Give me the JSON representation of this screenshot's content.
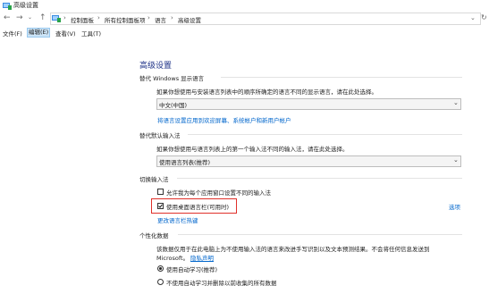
{
  "window": {
    "title": "高级设置"
  },
  "nav": {
    "back_glyph": "←",
    "forward_glyph": "→",
    "recent_glyph": "⌄",
    "up_glyph": "↑",
    "breadcrumbs": [
      "控制面板",
      "所有控制面板项",
      "语言",
      "高级设置"
    ],
    "separator": "›",
    "dropdown_glyph": "⌄",
    "refresh_glyph": "↻"
  },
  "menu": {
    "items": [
      "文件(F)",
      "编辑(E)",
      "查看(V)",
      "工具(T)"
    ]
  },
  "page": {
    "heading": "高级设置",
    "display_language": {
      "title": "替代 Windows 显示语言",
      "description": "如果你想使用与安装语言列表中的顺序所确定的语言不同的显示语言，请在此处选择。",
      "selected": "中文(中国)",
      "link": "将语言设置应用到欢迎屏幕、系统帐户和新用户帐户"
    },
    "default_input": {
      "title": "替代默认输入法",
      "description": "如果你想使用与语言列表上的第一个输入法不同的输入法，请在此处选择。",
      "selected": "使用语言列表(推荐)"
    },
    "switch_input": {
      "title": "切换输入法",
      "checkbox1_label": "允许我为每个应用窗口设置不同的输入法",
      "checkbox1_checked": false,
      "checkbox2_label": "使用桌面语言栏(可用时)",
      "checkbox2_checked": true,
      "options_link": "选项",
      "hotkeys_link": "更改语言栏热键"
    },
    "personalization": {
      "title": "个性化数据",
      "description_line1": "该数据仅用于在此电脑上为不使用输入法的语言来改进手写识别以及文本预测结果。不会将任何信息发送到",
      "description_line2_prefix": "Microsoft。",
      "privacy_link": "隐私声明",
      "radio1_label": "使用自动学习(推荐)",
      "radio1_selected": true,
      "radio2_label": "不使用自动学习并删除以前收集的所有数据",
      "radio2_selected": false
    }
  },
  "colors": {
    "heading": "#1e3287",
    "link": "#0066cc",
    "highlight_box": "#e0302a",
    "menu_active_bg": "#cce4f7"
  }
}
